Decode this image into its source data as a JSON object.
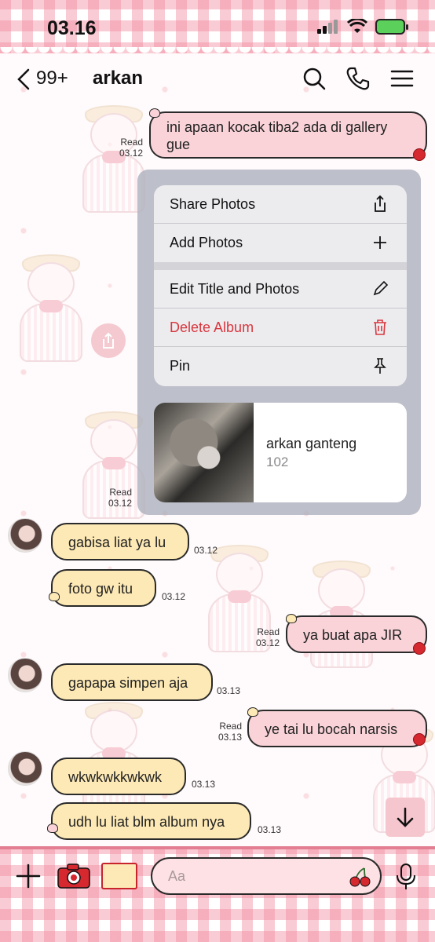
{
  "status_bar": {
    "time": "03.16"
  },
  "header": {
    "back_count": "99+",
    "title": "arkan",
    "icons": [
      "search-icon",
      "phone-icon",
      "menu-icon"
    ]
  },
  "messages": [
    {
      "side": "out",
      "text_line1": "ini apaan kocak tiba2 ada di gallery",
      "text_line2": "gue",
      "read": "Read",
      "time": "03.12"
    },
    {
      "side": "out-hidden",
      "read": "Read",
      "time": "03.12"
    },
    {
      "side": "in",
      "text": "gabisa liat ya lu",
      "time": "03.12"
    },
    {
      "side": "in",
      "text": "foto gw itu",
      "time": "03.12"
    },
    {
      "side": "out",
      "text": "ya buat apa JIR",
      "read": "Read",
      "time": "03.12"
    },
    {
      "side": "in",
      "text": "gapapa simpen aja",
      "time": "03.13"
    },
    {
      "side": "out",
      "text": "ye tai lu bocah narsis",
      "read": "Read",
      "time": "03.13"
    },
    {
      "side": "in",
      "text": "wkwkwkkwkwk",
      "time": "03.13"
    },
    {
      "side": "in",
      "text": "udh lu liat blm album nya",
      "time": "03.13"
    }
  ],
  "context_menu": {
    "items": [
      {
        "label": "Share Photos",
        "icon": "share-icon"
      },
      {
        "label": "Add Photos",
        "icon": "plus-icon"
      },
      {
        "label": "Edit Title and Photos",
        "icon": "pencil-icon"
      },
      {
        "label": "Delete Album",
        "icon": "trash-icon",
        "color": "#d9363e"
      },
      {
        "label": "Pin",
        "icon": "pin-icon"
      }
    ]
  },
  "album": {
    "name": "arkan ganteng",
    "count": "102"
  },
  "composer": {
    "placeholder": "Aa"
  },
  "colors": {
    "outgoing_bubble": "#f9d3d8",
    "incoming_bubble": "#fde9b5",
    "accent": "#e37e92",
    "danger": "#d9363e"
  }
}
